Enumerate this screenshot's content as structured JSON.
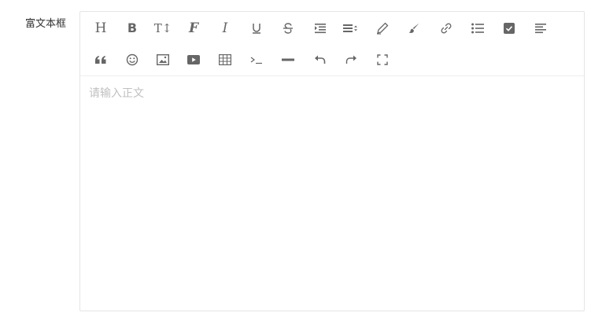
{
  "field": {
    "label": "富文本框"
  },
  "editor": {
    "placeholder": "请输入正文",
    "toolbar_row1": [
      {
        "name": "heading",
        "glyph": "H"
      },
      {
        "name": "bold",
        "glyph": "B"
      },
      {
        "name": "font-size",
        "glyph": "T↕"
      },
      {
        "name": "font-family",
        "glyph": "F"
      },
      {
        "name": "italic",
        "glyph": "I"
      },
      {
        "name": "underline",
        "glyph": "U"
      },
      {
        "name": "strikethrough",
        "glyph": "S"
      },
      {
        "name": "indent",
        "glyph": ""
      },
      {
        "name": "line-height",
        "glyph": ""
      },
      {
        "name": "font-color",
        "glyph": ""
      },
      {
        "name": "background-color",
        "glyph": ""
      },
      {
        "name": "link",
        "glyph": ""
      },
      {
        "name": "list",
        "glyph": ""
      },
      {
        "name": "todo",
        "glyph": ""
      },
      {
        "name": "justify",
        "glyph": ""
      }
    ],
    "toolbar_row2": [
      {
        "name": "quote",
        "glyph": "66"
      },
      {
        "name": "emoticon",
        "glyph": ""
      },
      {
        "name": "image",
        "glyph": ""
      },
      {
        "name": "video",
        "glyph": ""
      },
      {
        "name": "table",
        "glyph": ""
      },
      {
        "name": "code",
        "glyph": ""
      },
      {
        "name": "divider",
        "glyph": ""
      },
      {
        "name": "undo",
        "glyph": ""
      },
      {
        "name": "redo",
        "glyph": ""
      },
      {
        "name": "fullscreen",
        "glyph": ""
      }
    ]
  },
  "colors": {
    "icon": "#666666",
    "border": "#e5e5e5",
    "placeholder": "#c0c0c0"
  }
}
